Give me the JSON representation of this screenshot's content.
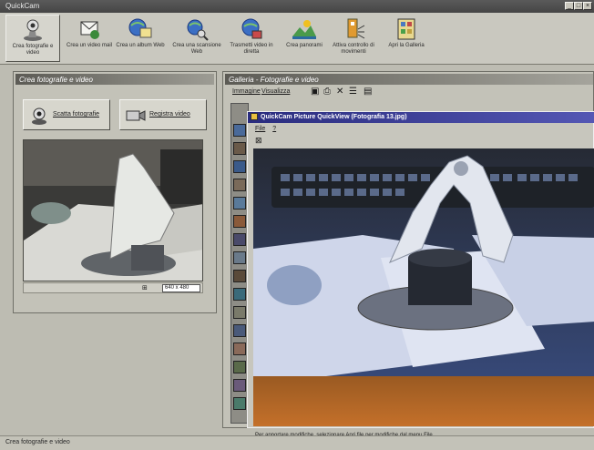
{
  "window": {
    "title": "QuickCam"
  },
  "toolbar": {
    "items": [
      {
        "label": "Crea fotografie e video",
        "icon": "camera-icon"
      },
      {
        "label": "Crea un video mail",
        "icon": "video-mail-icon"
      },
      {
        "label": "Crea un album Web",
        "icon": "web-album-icon"
      },
      {
        "label": "Crea una scansione Web",
        "icon": "web-search-icon"
      },
      {
        "label": "Trasmetti video in diretta",
        "icon": "live-broadcast-icon"
      },
      {
        "label": "Crea panorami",
        "icon": "panorama-icon"
      },
      {
        "label": "Attiva controllo di movimenti",
        "icon": "motion-detect-icon"
      },
      {
        "label": "Apri la Galleria",
        "icon": "gallery-icon"
      }
    ]
  },
  "left_panel": {
    "title": "Crea fotografie e video",
    "snap_button": "Scatta fotografie",
    "record_button": "Registra video",
    "resolution": "640 x 480"
  },
  "gallery": {
    "title": "Galleria - Fotografie e video",
    "menu": [
      "Immagine",
      "Visualizza"
    ]
  },
  "quickview": {
    "title": "QuickCam Picture QuickView (Fotografia 13.jpg)",
    "menu": [
      "File",
      "?"
    ],
    "status": "Per apportare modifiche, selezionare Apri file per modifiche dal menu File."
  },
  "statusbar": {
    "text": "Crea fotografie e video"
  },
  "colors": {
    "quickview_titlebar": "#2a2c7e",
    "panel_header": "#5c5b55"
  }
}
